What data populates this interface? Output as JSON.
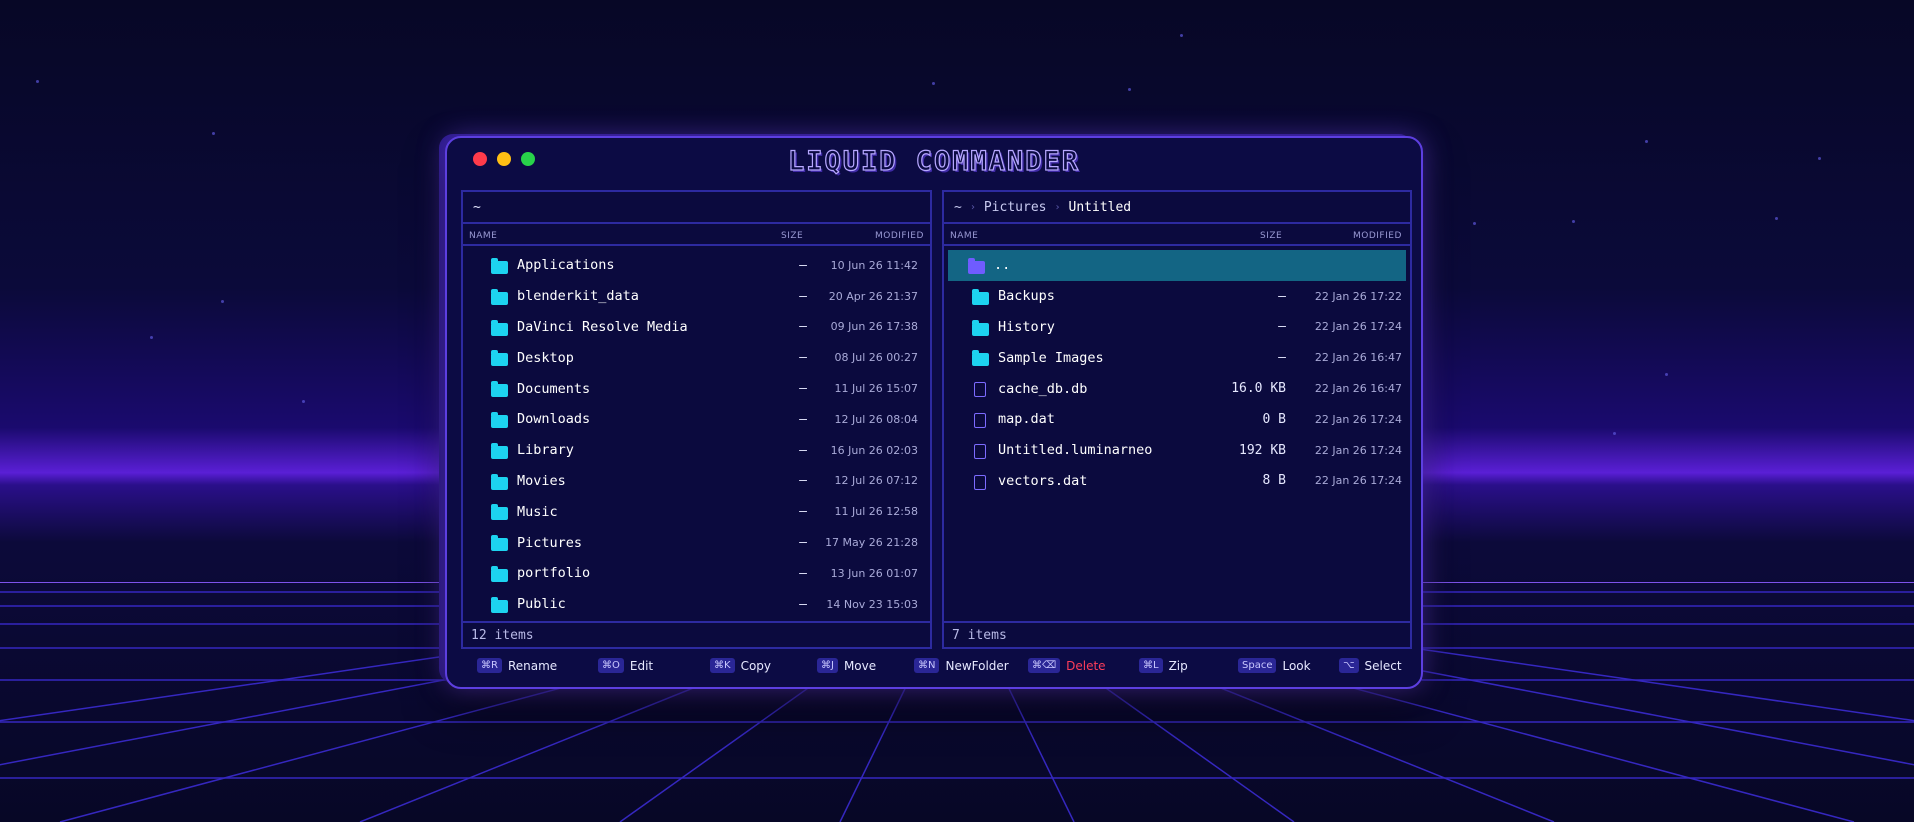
{
  "app": {
    "title": "LIQUID COMMANDER"
  },
  "left_pane": {
    "path": "~",
    "columns": {
      "name": "NAME",
      "size": "SIZE",
      "modified": "MODIFIED"
    },
    "rows": [
      {
        "name": "Applications",
        "size": "–",
        "modified": "10 Jun 26 11:42",
        "type": "folder"
      },
      {
        "name": "blenderkit_data",
        "size": "–",
        "modified": "20 Apr 26 21:37",
        "type": "folder"
      },
      {
        "name": "DaVinci Resolve Media",
        "size": "–",
        "modified": "09 Jun 26 17:38",
        "type": "folder"
      },
      {
        "name": "Desktop",
        "size": "–",
        "modified": "08 Jul 26 00:27",
        "type": "folder"
      },
      {
        "name": "Documents",
        "size": "–",
        "modified": "11 Jul 26 15:07",
        "type": "folder"
      },
      {
        "name": "Downloads",
        "size": "–",
        "modified": "12 Jul 26 08:04",
        "type": "folder"
      },
      {
        "name": "Library",
        "size": "–",
        "modified": "16 Jun 26 02:03",
        "type": "folder"
      },
      {
        "name": "Movies",
        "size": "–",
        "modified": "12 Jul 26 07:12",
        "type": "folder"
      },
      {
        "name": "Music",
        "size": "–",
        "modified": "11 Jul 26 12:58",
        "type": "folder"
      },
      {
        "name": "Pictures",
        "size": "–",
        "modified": "17 May 26 21:28",
        "type": "folder"
      },
      {
        "name": "portfolio",
        "size": "–",
        "modified": "13 Jun 26 01:07",
        "type": "folder"
      },
      {
        "name": "Public",
        "size": "–",
        "modified": "14 Nov 23 15:03",
        "type": "folder"
      }
    ],
    "status": "12 items"
  },
  "right_pane": {
    "breadcrumb": [
      "~",
      "Pictures",
      "Untitled"
    ],
    "columns": {
      "name": "NAME",
      "size": "SIZE",
      "modified": "MODIFIED"
    },
    "rows": [
      {
        "name": "..",
        "size": "",
        "modified": "",
        "type": "parent"
      },
      {
        "name": "Backups",
        "size": "–",
        "modified": "22 Jan 26 17:22",
        "type": "folder"
      },
      {
        "name": "History",
        "size": "–",
        "modified": "22 Jan 26 17:24",
        "type": "folder"
      },
      {
        "name": "Sample Images",
        "size": "–",
        "modified": "22 Jan 26 16:47",
        "type": "folder"
      },
      {
        "name": "cache_db.db",
        "size": "16.0 KB",
        "modified": "22 Jan 26 16:47",
        "type": "file"
      },
      {
        "name": "map.dat",
        "size": "0 B",
        "modified": "22 Jan 26 17:24",
        "type": "file"
      },
      {
        "name": "Untitled.luminarneo",
        "size": "192 KB",
        "modified": "22 Jan 26 17:24",
        "type": "file"
      },
      {
        "name": "vectors.dat",
        "size": "8 B",
        "modified": "22 Jan 26 17:24",
        "type": "file"
      }
    ],
    "status": "7 items"
  },
  "shortcuts": [
    {
      "key": "⌘R",
      "label": "Rename"
    },
    {
      "key": "⌘O",
      "label": "Edit"
    },
    {
      "key": "⌘K",
      "label": "Copy"
    },
    {
      "key": "⌘J",
      "label": "Move"
    },
    {
      "key": "⌘N",
      "label": "NewFolder"
    },
    {
      "key": "⌘⌫",
      "label": "Delete"
    },
    {
      "key": "⌘L",
      "label": "Zip"
    },
    {
      "key": "Space",
      "label": "Look"
    },
    {
      "key": "⌥",
      "label": "Select"
    }
  ],
  "colors": {
    "accent": "#5d3fe0",
    "folder": "#1dd3f0",
    "selection": "#136584",
    "danger": "#ff3d5a"
  }
}
